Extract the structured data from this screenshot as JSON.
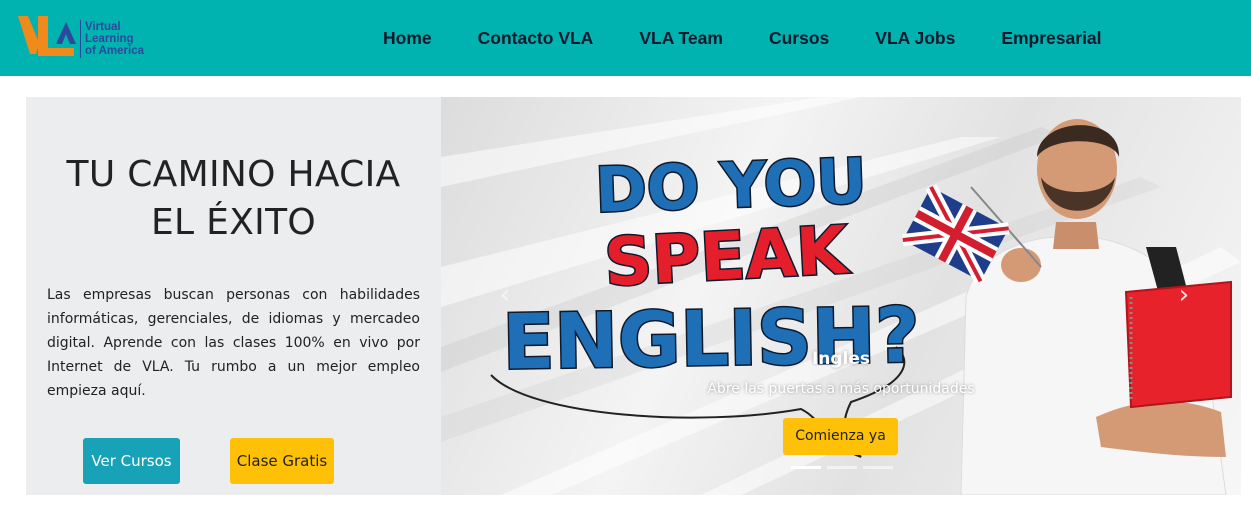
{
  "header": {
    "logo": {
      "mark_text": "VLA",
      "lines": [
        "Virtual",
        "Learning",
        "of America"
      ]
    },
    "nav": [
      {
        "label": "Home"
      },
      {
        "label": "Contacto VLA"
      },
      {
        "label": "VLA Team"
      },
      {
        "label": "Cursos"
      },
      {
        "label": "VLA Jobs"
      },
      {
        "label": "Empresarial"
      }
    ]
  },
  "hero": {
    "title_line1": "TU CAMINO HACIA",
    "title_line2": "EL ÉXITO",
    "description": "Las empresas buscan personas con habilidades informáticas, gerenciales, de idiomas y mercadeo digital. Aprende con las clases 100% en vivo por Internet de VLA. Tu rumbo a un mejor empleo empieza aquí.",
    "buttons": {
      "courses": "Ver Cursos",
      "free_class": "Clase Gratis"
    }
  },
  "slider": {
    "image_text": [
      "DO YOU",
      "SPEAK",
      "ENGLISH?"
    ],
    "caption_title": "Ingles",
    "caption_subtitle": "Abre las puertas a más oportunidades",
    "cta": "Comienza ya",
    "indicator_count": 3,
    "active_indicator": 1,
    "prev_icon": "chevron-left-icon",
    "next_icon": "chevron-right-icon"
  },
  "colors": {
    "header_bg": "#00b2b0",
    "logo_orange": "#f08a1c",
    "logo_blue": "#2c4a9c",
    "button_teal": "#17a2b8",
    "button_yellow": "#ffc107",
    "hero_left_bg": "#ecedef",
    "speak_red": "#e41e2b",
    "english_blue": "#1f6fb6"
  }
}
